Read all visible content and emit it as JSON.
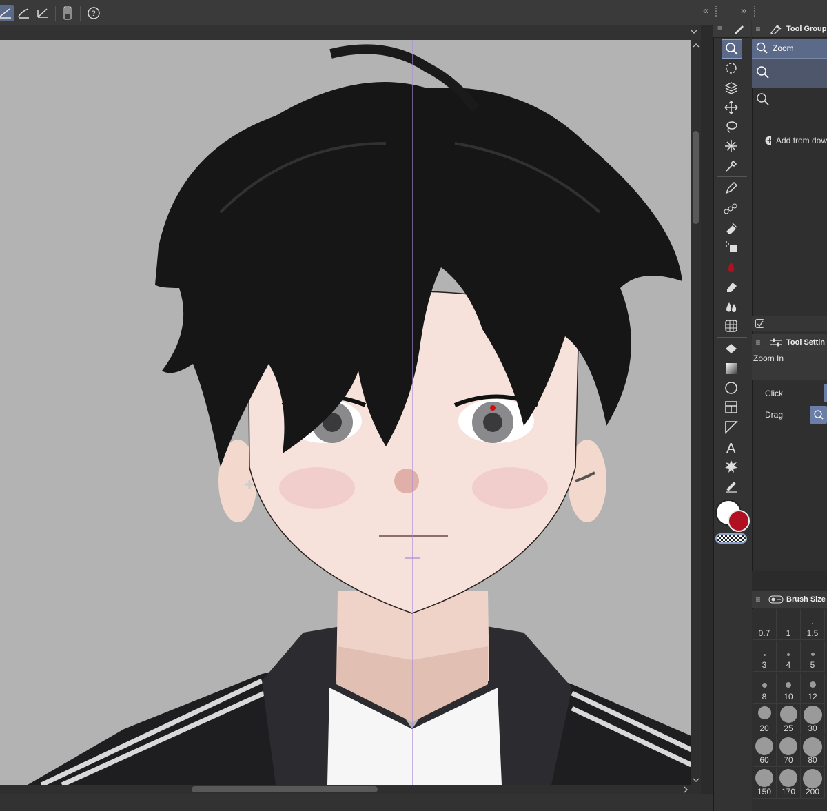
{
  "collapse_left_icon": "«",
  "collapse_right_icon": "»",
  "panel_menu_icon": "≡",
  "tool_group_panel": {
    "title": "Tool Group",
    "selected_item": "Zoom"
  },
  "sub_tool_panel": {
    "add_label": "Add from dow"
  },
  "tool_settings_panel": {
    "title": "Tool Settin",
    "mode": "Zoom In",
    "click_label": "Click",
    "drag_label": "Drag"
  },
  "brush_size_panel": {
    "title": "Brush Size",
    "sizes": [
      "0.7",
      "1",
      "1.5",
      "3",
      "4",
      "5",
      "8",
      "10",
      "12",
      "20",
      "25",
      "30",
      "60",
      "70",
      "80",
      "150",
      "170",
      "200"
    ]
  },
  "colors": {
    "accent": "#5b6a89",
    "main_color": "#ffffff",
    "sub_color": "#b01020",
    "canvas_bg": "#b3b3b3",
    "guide_line": "#a78ad8"
  },
  "tools": [
    "zoom-icon",
    "rotate-icon",
    "layer-select-icon",
    "move-icon",
    "lasso-icon",
    "auto-select-icon",
    "eyedropper-icon",
    "pen-icon",
    "brush-decoration-icon",
    "airbrush-icon",
    "decoration-icon",
    "blend-drop-icon",
    "eraser-icon",
    "blend-icon",
    "grid-icon",
    "fill-icon",
    "gradient-icon",
    "figure-icon",
    "frame-icon",
    "ruler-icon",
    "text-icon",
    "balloon-icon",
    "correct-line-icon"
  ]
}
